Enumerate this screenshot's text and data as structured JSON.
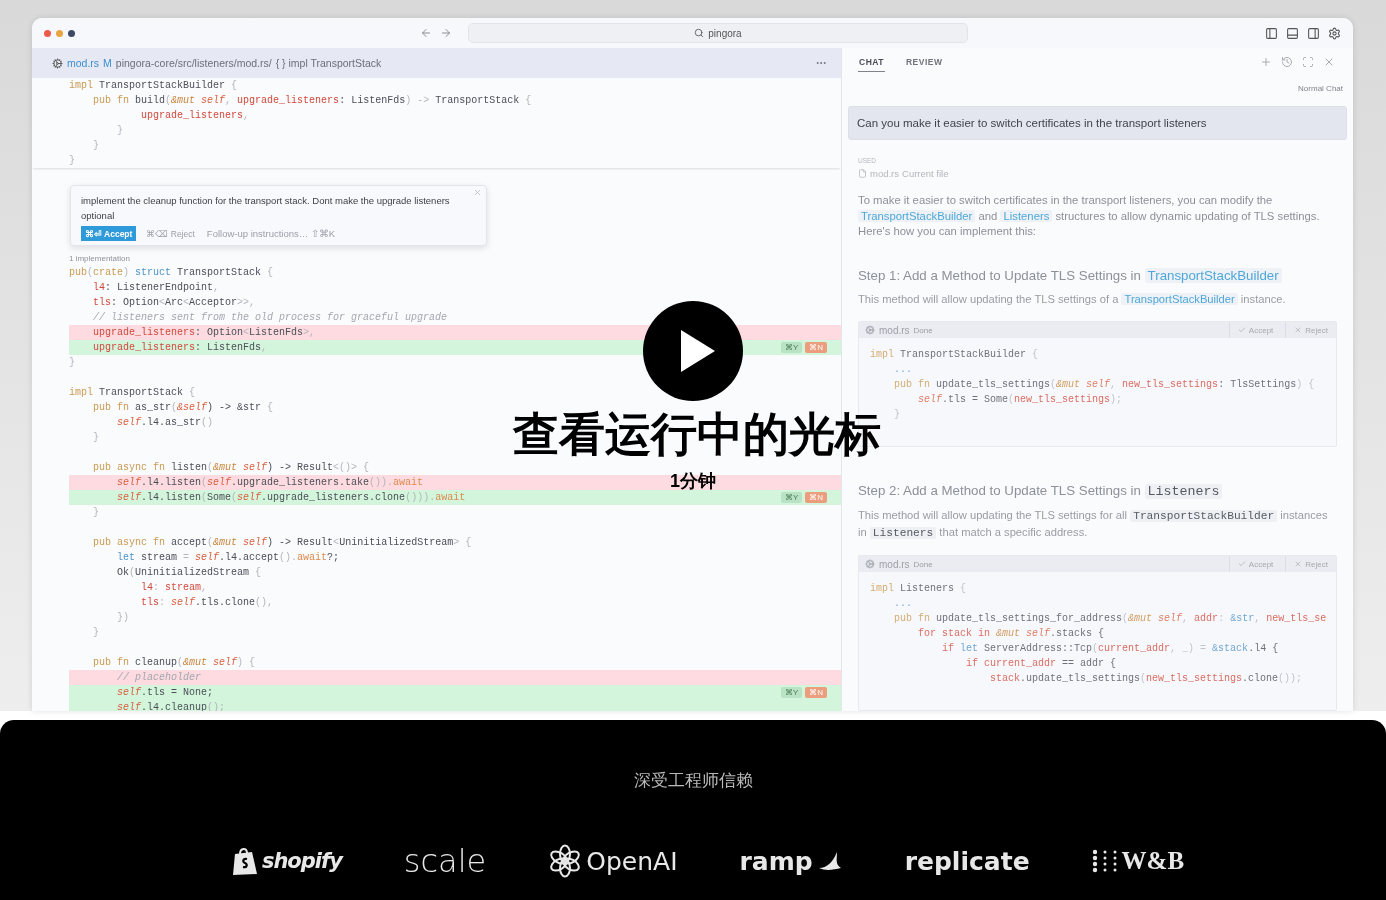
{
  "toolbar": {
    "search": "pingora"
  },
  "editor": {
    "file": "mod.rs",
    "status": "M",
    "path": "pingora-core/src/listeners/mod.rs/",
    "symbol": "{ } impl TransportStack",
    "sticky_lines": [
      {
        "kind": "context",
        "tokens": [
          {
            "text": "impl ",
            "kind": "k"
          },
          {
            "text": "TransportStackBuilder ",
            "kind": "n"
          },
          {
            "text": "{",
            "kind": "p"
          }
        ]
      },
      {
        "kind": "context",
        "tokens": [
          {
            "text": "    pub fn ",
            "kind": "k"
          },
          {
            "text": "build",
            "kind": "n"
          },
          {
            "text": "(",
            "kind": "p"
          },
          {
            "text": "&mut ",
            "kind": "m"
          },
          {
            "text": "self",
            "kind": "s"
          },
          {
            "text": ", ",
            "kind": "p"
          },
          {
            "text": "upgrade_listeners",
            "kind": "f"
          },
          {
            "text": ": ListenFds",
            "kind": "n"
          },
          {
            "text": ") -> ",
            "kind": "p"
          },
          {
            "text": "TransportStack ",
            "kind": "n"
          },
          {
            "text": "{",
            "kind": "p"
          }
        ]
      },
      {
        "kind": "context",
        "tokens": [
          {
            "text": "            upgrade_listeners",
            "kind": "f"
          },
          {
            "text": ",",
            "kind": "p"
          }
        ]
      },
      {
        "kind": "context",
        "tokens": [
          {
            "text": "        }",
            "kind": "p"
          }
        ]
      },
      {
        "kind": "context",
        "tokens": [
          {
            "text": "    }",
            "kind": "p"
          }
        ]
      },
      {
        "kind": "context",
        "tokens": [
          {
            "text": "}",
            "kind": "p"
          }
        ]
      }
    ],
    "prompt": {
      "text": "implement the cleanup function for the transport stack. Dont make the upgrade listeners optional",
      "accept": "⌘⏎ Accept",
      "reject": "⌘⌫ Reject",
      "placeholder": "Follow-up instructions… ⇧⌘K"
    },
    "implementations": "1 implementation",
    "lines": [
      {
        "kind": "context",
        "tokens": [
          {
            "text": "pub",
            "kind": "k"
          },
          {
            "text": "(",
            "kind": "p"
          },
          {
            "text": "crate",
            "kind": "k"
          },
          {
            "text": ") ",
            "kind": "p"
          },
          {
            "text": "struct ",
            "kind": "b"
          },
          {
            "text": "TransportStack ",
            "kind": "n"
          },
          {
            "text": "{",
            "kind": "p"
          }
        ]
      },
      {
        "kind": "context",
        "tokens": [
          {
            "text": "    l4",
            "kind": "f"
          },
          {
            "text": ": ListenerEndpoint",
            "kind": "n"
          },
          {
            "text": ",",
            "kind": "p"
          }
        ]
      },
      {
        "kind": "context",
        "tokens": [
          {
            "text": "    tls",
            "kind": "f"
          },
          {
            "text": ": Option",
            "kind": "n"
          },
          {
            "text": "<",
            "kind": "p"
          },
          {
            "text": "Arc",
            "kind": "n"
          },
          {
            "text": "<",
            "kind": "p"
          },
          {
            "text": "Acceptor",
            "kind": "n"
          },
          {
            "text": ">>,",
            "kind": "p"
          }
        ]
      },
      {
        "kind": "context",
        "tokens": [
          {
            "text": "    // listeners sent from the old process for graceful upgrade",
            "kind": "c"
          }
        ]
      },
      {
        "kind": "removed",
        "tokens": [
          {
            "text": "    upgrade_listeners",
            "kind": "f"
          },
          {
            "text": ": Option",
            "kind": "n"
          },
          {
            "text": "<",
            "kind": "p"
          },
          {
            "text": "ListenFds",
            "kind": "n"
          },
          {
            "text": ">,",
            "kind": "p"
          }
        ]
      },
      {
        "kind": "added",
        "tokens": [
          {
            "text": "    upgrade_listeners",
            "kind": "f"
          },
          {
            "text": ": ListenFds",
            "kind": "n"
          },
          {
            "text": ",",
            "kind": "p"
          }
        ],
        "actions": [
          "⌘Y",
          "⌘N"
        ]
      },
      {
        "kind": "context",
        "tokens": [
          {
            "text": "}",
            "kind": "p"
          }
        ]
      },
      {
        "kind": "blank"
      },
      {
        "kind": "context",
        "tokens": [
          {
            "text": "impl ",
            "kind": "k"
          },
          {
            "text": "TransportStack ",
            "kind": "n"
          },
          {
            "text": "{",
            "kind": "p"
          }
        ]
      },
      {
        "kind": "context",
        "tokens": [
          {
            "text": "    pub fn ",
            "kind": "k"
          },
          {
            "text": "as_str",
            "kind": "n"
          },
          {
            "text": "(",
            "kind": "p"
          },
          {
            "text": "&self",
            "kind": "s"
          },
          {
            "text": ") -> &str ",
            "kind": "n"
          },
          {
            "text": "{",
            "kind": "p"
          }
        ]
      },
      {
        "kind": "context",
        "tokens": [
          {
            "text": "        self",
            "kind": "s"
          },
          {
            "text": ".l4.as_str",
            "kind": "n"
          },
          {
            "text": "()",
            "kind": "p"
          }
        ]
      },
      {
        "kind": "context",
        "tokens": [
          {
            "text": "    }",
            "kind": "p"
          }
        ]
      },
      {
        "kind": "blank"
      },
      {
        "kind": "context",
        "tokens": [
          {
            "text": "    pub async fn ",
            "kind": "k"
          },
          {
            "text": "listen",
            "kind": "n"
          },
          {
            "text": "(",
            "kind": "p"
          },
          {
            "text": "&mut ",
            "kind": "m"
          },
          {
            "text": "self",
            "kind": "s"
          },
          {
            "text": ") -> Result",
            "kind": "n"
          },
          {
            "text": "<()> {",
            "kind": "p"
          }
        ]
      },
      {
        "kind": "removed",
        "tokens": [
          {
            "text": "        self",
            "kind": "s"
          },
          {
            "text": ".l4.listen",
            "kind": "n"
          },
          {
            "text": "(",
            "kind": "p"
          },
          {
            "text": "self",
            "kind": "s"
          },
          {
            "text": ".upgrade_listeners.take",
            "kind": "n"
          },
          {
            "text": "()).",
            "kind": "p"
          },
          {
            "text": "await",
            "kind": "a"
          }
        ]
      },
      {
        "kind": "added",
        "tokens": [
          {
            "text": "        self",
            "kind": "s"
          },
          {
            "text": ".l4.listen",
            "kind": "n"
          },
          {
            "text": "(",
            "kind": "p"
          },
          {
            "text": "Some",
            "kind": "n"
          },
          {
            "text": "(",
            "kind": "p"
          },
          {
            "text": "self",
            "kind": "s"
          },
          {
            "text": ".upgrade_listeners.clone",
            "kind": "n"
          },
          {
            "text": "())).",
            "kind": "p"
          },
          {
            "text": "await",
            "kind": "a"
          }
        ],
        "actions": [
          "⌘Y",
          "⌘N"
        ]
      },
      {
        "kind": "context",
        "tokens": [
          {
            "text": "    }",
            "kind": "p"
          }
        ]
      },
      {
        "kind": "blank"
      },
      {
        "kind": "context",
        "tokens": [
          {
            "text": "    pub async fn ",
            "kind": "k"
          },
          {
            "text": "accept",
            "kind": "n"
          },
          {
            "text": "(",
            "kind": "p"
          },
          {
            "text": "&mut ",
            "kind": "m"
          },
          {
            "text": "self",
            "kind": "s"
          },
          {
            "text": ") -> Result",
            "kind": "n"
          },
          {
            "text": "<",
            "kind": "p"
          },
          {
            "text": "UninitializedStream",
            "kind": "n"
          },
          {
            "text": "> {",
            "kind": "p"
          }
        ]
      },
      {
        "kind": "context",
        "tokens": [
          {
            "text": "        let ",
            "kind": "b"
          },
          {
            "text": "stream",
            "kind": "n"
          },
          {
            "text": " = ",
            "kind": "p"
          },
          {
            "text": "self",
            "kind": "s"
          },
          {
            "text": ".l4.accept",
            "kind": "n"
          },
          {
            "text": "().",
            "kind": "p"
          },
          {
            "text": "await",
            "kind": "a"
          },
          {
            "text": "?;",
            "kind": "n"
          }
        ]
      },
      {
        "kind": "context",
        "tokens": [
          {
            "text": "        Ok",
            "kind": "n"
          },
          {
            "text": "(",
            "kind": "p"
          },
          {
            "text": "UninitializedStream ",
            "kind": "n"
          },
          {
            "text": "{",
            "kind": "p"
          }
        ]
      },
      {
        "kind": "context",
        "tokens": [
          {
            "text": "            l4",
            "kind": "f"
          },
          {
            "text": ": ",
            "kind": "p"
          },
          {
            "text": "stream",
            "kind": "f"
          },
          {
            "text": ",",
            "kind": "p"
          }
        ]
      },
      {
        "kind": "context",
        "tokens": [
          {
            "text": "            tls",
            "kind": "f"
          },
          {
            "text": ": ",
            "kind": "p"
          },
          {
            "text": "self",
            "kind": "s"
          },
          {
            "text": ".tls.clone",
            "kind": "n"
          },
          {
            "text": "(),",
            "kind": "p"
          }
        ]
      },
      {
        "kind": "context",
        "tokens": [
          {
            "text": "        })",
            "kind": "p"
          }
        ]
      },
      {
        "kind": "context",
        "tokens": [
          {
            "text": "    }",
            "kind": "p"
          }
        ]
      },
      {
        "kind": "blank"
      },
      {
        "kind": "context",
        "tokens": [
          {
            "text": "    pub fn ",
            "kind": "k"
          },
          {
            "text": "cleanup",
            "kind": "n"
          },
          {
            "text": "(",
            "kind": "p"
          },
          {
            "text": "&mut ",
            "kind": "m"
          },
          {
            "text": "self",
            "kind": "s"
          },
          {
            "text": ") {",
            "kind": "p"
          }
        ]
      },
      {
        "kind": "removed",
        "tokens": [
          {
            "text": "        // placeholder",
            "kind": "c"
          }
        ]
      },
      {
        "kind": "added",
        "tokens": [
          {
            "text": "        self",
            "kind": "s"
          },
          {
            "text": ".tls = None;",
            "kind": "n"
          }
        ],
        "actions": [
          "⌘Y",
          "⌘N"
        ]
      },
      {
        "kind": "added",
        "tokens": [
          {
            "text": "        self",
            "kind": "s"
          },
          {
            "text": ".l4.cleanup",
            "kind": "n"
          },
          {
            "text": "();",
            "kind": "p"
          }
        ]
      }
    ]
  },
  "chat": {
    "tabs": [
      {
        "label": "CHAT",
        "selected": true
      },
      {
        "label": "REVIEW",
        "selected": false
      }
    ],
    "mode": "Normal Chat",
    "question": "Can you make it easier to switch certificates in the transport listeners",
    "used_label": "USED",
    "used_file": "mod.rs",
    "used_note": "Current file",
    "intro": [
      {
        "text": "To make it easier to switch certificates in the transport listeners, you can modify the ",
        "kind": "plain"
      },
      {
        "text": "TransportStackBuilder",
        "kind": "ref"
      },
      {
        "text": " and ",
        "kind": "plain"
      },
      {
        "text": "Listeners",
        "kind": "ref"
      },
      {
        "text": " structures to allow dynamic updating of TLS settings. Here's how you can implement this:",
        "kind": "plain"
      }
    ],
    "steps": [
      {
        "heading": [
          {
            "text": "Step 1: Add a Method to Update TLS Settings in ",
            "kind": "plain"
          },
          {
            "text": "TransportStackBuilder",
            "kind": "ref"
          }
        ],
        "description": [
          {
            "text": "This method will allow updating the TLS settings of a ",
            "kind": "plain"
          },
          {
            "text": "TransportStackBuilder",
            "kind": "ref"
          },
          {
            "text": " instance.",
            "kind": "plain"
          }
        ],
        "block": {
          "file": "mod.rs",
          "status": "Done",
          "accept": "Accept",
          "reject": "Reject",
          "lines": [
            {
              "kind": "context",
              "tokens": [
                {
                  "text": "impl ",
                  "kind": "k"
                },
                {
                  "text": "TransportStackBuilder ",
                  "kind": "n"
                },
                {
                  "text": "{",
                  "kind": "p"
                }
              ]
            },
            {
              "kind": "context",
              "tokens": [
                {
                  "text": "    ...",
                  "kind": "b"
                }
              ]
            },
            {
              "kind": "context",
              "tokens": [
                {
                  "text": "    pub fn ",
                  "kind": "k"
                },
                {
                  "text": "update_tls_settings",
                  "kind": "n"
                },
                {
                  "text": "(",
                  "kind": "p"
                },
                {
                  "text": "&mut ",
                  "kind": "m"
                },
                {
                  "text": "self",
                  "kind": "s"
                },
                {
                  "text": ", ",
                  "kind": "p"
                },
                {
                  "text": "new_tls_settings",
                  "kind": "f"
                },
                {
                  "text": ": TlsSettings",
                  "kind": "n"
                },
                {
                  "text": ") {",
                  "kind": "p"
                }
              ]
            },
            {
              "kind": "context",
              "tokens": [
                {
                  "text": "        self",
                  "kind": "s"
                },
                {
                  "text": ".tls = Some",
                  "kind": "n"
                },
                {
                  "text": "(",
                  "kind": "p"
                },
                {
                  "text": "new_tls_settings",
                  "kind": "f"
                },
                {
                  "text": ");",
                  "kind": "p"
                }
              ]
            },
            {
              "kind": "context",
              "tokens": [
                {
                  "text": "    }",
                  "kind": "p"
                }
              ]
            }
          ]
        }
      },
      {
        "heading": [
          {
            "text": "Step 2: Add a Method to Update TLS Settings in ",
            "kind": "plain"
          },
          {
            "text": "Listeners",
            "kind": "code"
          }
        ],
        "description": [
          {
            "text": "This method will allow updating the TLS settings for all ",
            "kind": "plain"
          },
          {
            "text": "TransportStackBuilder",
            "kind": "code"
          },
          {
            "text": " instances in ",
            "kind": "plain"
          },
          {
            "text": "Listeners",
            "kind": "code"
          },
          {
            "text": " that match a specific address.",
            "kind": "plain"
          }
        ],
        "block": {
          "file": "mod.rs",
          "status": "Done",
          "accept": "Accept",
          "reject": "Reject",
          "lines": [
            {
              "kind": "context",
              "tokens": [
                {
                  "text": "impl ",
                  "kind": "k"
                },
                {
                  "text": "Listeners ",
                  "kind": "n"
                },
                {
                  "text": "{",
                  "kind": "p"
                }
              ]
            },
            {
              "kind": "context",
              "tokens": [
                {
                  "text": "    ...",
                  "kind": "b"
                }
              ]
            },
            {
              "kind": "context",
              "tokens": [
                {
                  "text": "    pub fn ",
                  "kind": "k"
                },
                {
                  "text": "update_tls_settings_for_address",
                  "kind": "n"
                },
                {
                  "text": "(",
                  "kind": "p"
                },
                {
                  "text": "&mut ",
                  "kind": "m"
                },
                {
                  "text": "self",
                  "kind": "s"
                },
                {
                  "text": ", ",
                  "kind": "p"
                },
                {
                  "text": "addr",
                  "kind": "f"
                },
                {
                  "text": ": ",
                  "kind": "p"
                },
                {
                  "text": "&str",
                  "kind": "b"
                },
                {
                  "text": ", ",
                  "kind": "p"
                },
                {
                  "text": "new_tls_se",
                  "kind": "f"
                }
              ]
            },
            {
              "kind": "context",
              "tokens": [
                {
                  "text": "        for stack in ",
                  "kind": "f"
                },
                {
                  "text": "&mut ",
                  "kind": "m"
                },
                {
                  "text": "self",
                  "kind": "s"
                },
                {
                  "text": ".stacks {",
                  "kind": "n"
                }
              ]
            },
            {
              "kind": "context",
              "tokens": [
                {
                  "text": "            if ",
                  "kind": "f"
                },
                {
                  "text": "let ",
                  "kind": "b"
                },
                {
                  "text": "ServerAddress::Tcp",
                  "kind": "n"
                },
                {
                  "text": "(",
                  "kind": "p"
                },
                {
                  "text": "current_addr",
                  "kind": "f"
                },
                {
                  "text": ", _) = ",
                  "kind": "p"
                },
                {
                  "text": "&stack",
                  "kind": "b"
                },
                {
                  "text": ".l4 {",
                  "kind": "n"
                }
              ]
            },
            {
              "kind": "context",
              "tokens": [
                {
                  "text": "                if current_addr ",
                  "kind": "f"
                },
                {
                  "text": "== addr {",
                  "kind": "n"
                }
              ]
            },
            {
              "kind": "context",
              "tokens": [
                {
                  "text": "                    stack",
                  "kind": "f"
                },
                {
                  "text": ".update_tls_settings",
                  "kind": "n"
                },
                {
                  "text": "(",
                  "kind": "p"
                },
                {
                  "text": "new_tls_settings",
                  "kind": "f"
                },
                {
                  "text": ".clone",
                  "kind": "n"
                },
                {
                  "text": "());",
                  "kind": "p"
                }
              ]
            }
          ]
        }
      }
    ]
  },
  "video_overlay": {
    "title": "查看运行中的光标",
    "duration": "1分钟"
  },
  "trust": {
    "heading": "深受工程师信赖",
    "logos": [
      {
        "kind": "shopify",
        "text": "shopify"
      },
      {
        "kind": "scale",
        "text": "scale"
      },
      {
        "kind": "openai",
        "text": "OpenAI"
      },
      {
        "kind": "ramp",
        "text": "ramp"
      },
      {
        "kind": "replicate",
        "text": "replicate"
      },
      {
        "kind": "wandb",
        "text": "W&B"
      }
    ]
  }
}
